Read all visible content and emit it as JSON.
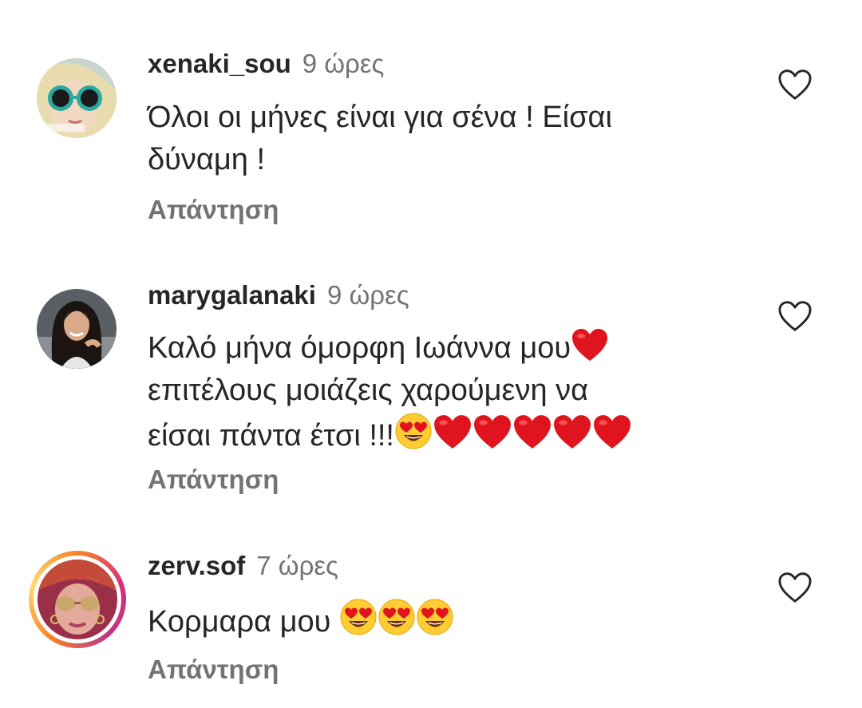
{
  "comments": [
    {
      "username": "xenaki_sou",
      "time": "9 ώρες",
      "lines": [
        "Όλοι οι μήνες είναι για σένα ! Είσαι",
        "δύναμη !"
      ],
      "reply_label": "Απάντηση",
      "avatar": "avatar-girl-sunglasses"
    },
    {
      "username": "marygalanaki",
      "time": "9 ώρες",
      "lines": [
        "Καλό μήνα όμορφη Ιωάννα μου",
        "επιτέλους μοιάζεις χαρούμενη να",
        "είσαι πάντα έτσι !!!"
      ],
      "reply_label": "Απάντηση",
      "avatar": "avatar-woman-dark-hair"
    },
    {
      "username": "zerv.sof",
      "time": "7 ώρες",
      "lines": [
        "Κορμαρα μου"
      ],
      "reply_label": "Απάντηση",
      "avatar": "avatar-woman-sunglasses-story-ring"
    }
  ],
  "icons": {
    "like": "heart-outline-icon",
    "emoji_love": "red-heart-emoji",
    "emoji_heart_eyes": "heart-eyes-emoji"
  },
  "colors": {
    "text": "#262626",
    "secondary": "#737373",
    "heart_red": "#e0141e",
    "emoji_yellow": "#ffcc33"
  }
}
